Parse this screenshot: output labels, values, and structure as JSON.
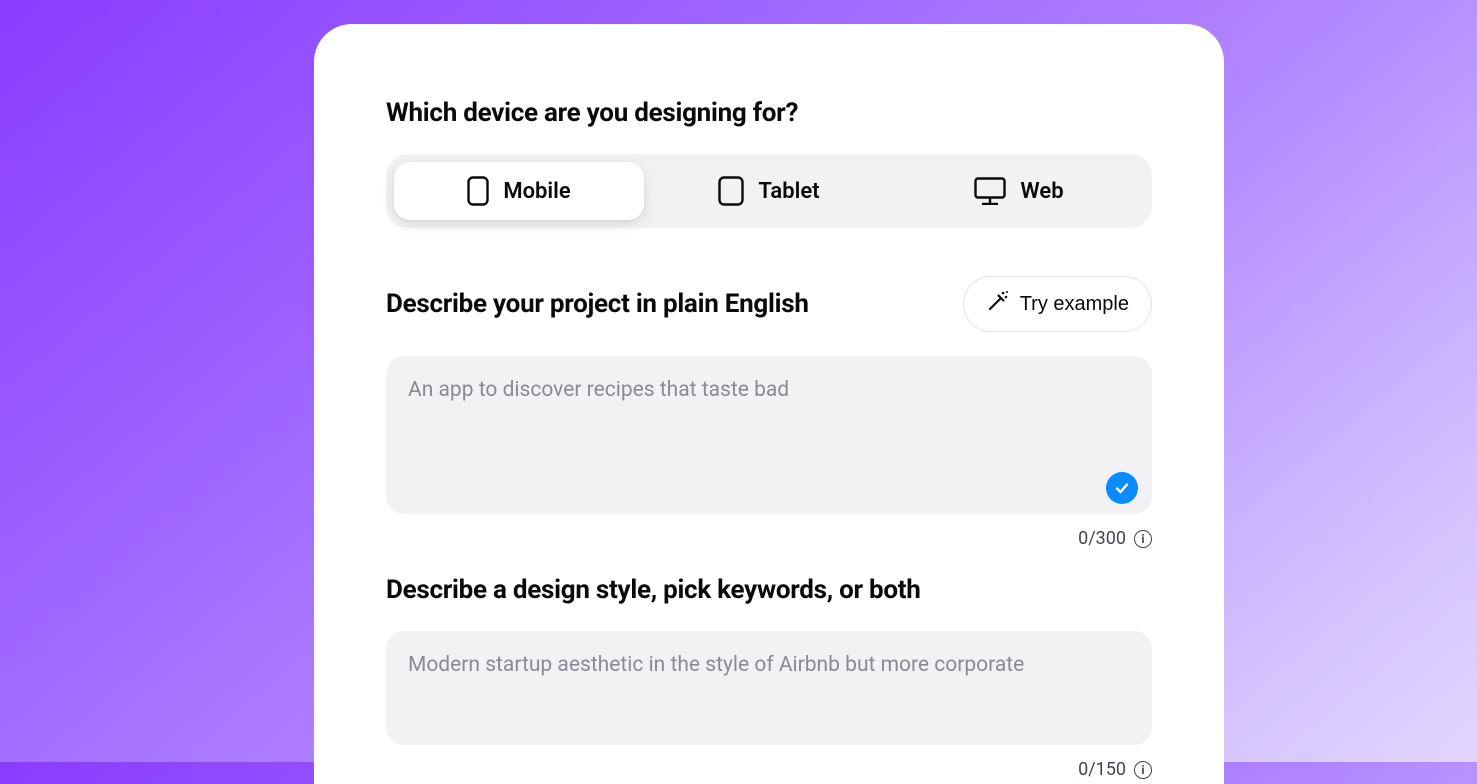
{
  "device_section": {
    "heading": "Which device are you designing for?",
    "tabs": [
      {
        "id": "mobile",
        "label": "Mobile",
        "active": true
      },
      {
        "id": "tablet",
        "label": "Tablet",
        "active": false
      },
      {
        "id": "web",
        "label": "Web",
        "active": false
      }
    ]
  },
  "project_section": {
    "heading": "Describe your project in plain English",
    "try_example_label": "Try example",
    "placeholder": "An app to discover recipes that taste bad",
    "value": "",
    "counter": "0/300",
    "valid": true
  },
  "style_section": {
    "heading": "Describe a design style, pick keywords, or both",
    "placeholder": "Modern startup aesthetic in the style of Airbnb but more corporate",
    "value": "",
    "counter": "0/150"
  },
  "icons": {
    "info_glyph": "i"
  }
}
